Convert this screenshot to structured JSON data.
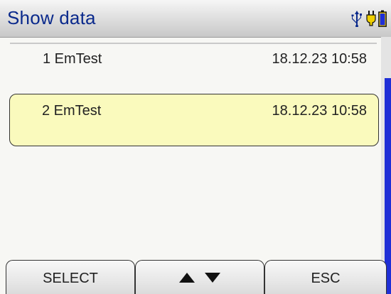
{
  "header": {
    "title": "Show data",
    "icons": [
      "usb-icon",
      "power-plug-icon",
      "battery-icon"
    ]
  },
  "records": [
    {
      "label": "1 EmTest",
      "date": "18.12.23 10:58",
      "selected": false
    },
    {
      "label": "2 EmTest",
      "date": "18.12.23 10:58",
      "selected": true
    }
  ],
  "softkeys": {
    "left": "SELECT",
    "middle_icons": [
      "arrow-up-icon",
      "arrow-down-icon"
    ],
    "right": "ESC"
  },
  "colors": {
    "title_text": "#0b2a8c",
    "selection_fill": "#fafabd",
    "scrollbar_thumb": "#1f2fd6",
    "plug_icon": "#f0d000"
  }
}
